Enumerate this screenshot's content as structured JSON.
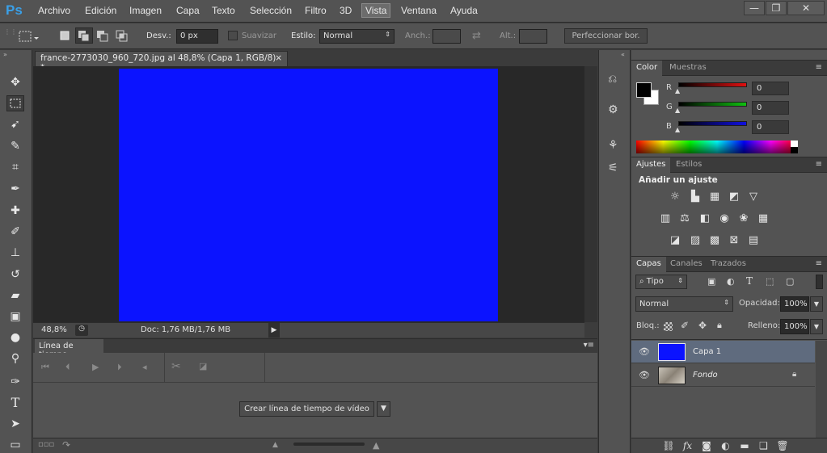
{
  "app": {
    "logo": "Ps",
    "window_buttons": [
      "—",
      "❐",
      "✕"
    ]
  },
  "menu": [
    "Archivo",
    "Edición",
    "Imagen",
    "Capa",
    "Texto",
    "Selección",
    "Filtro",
    "3D",
    "Vista",
    "Ventana",
    "Ayuda"
  ],
  "menu_active": "Vista",
  "options": {
    "desv_label": "Desv.:",
    "desv_value": "0 px",
    "suavizar_label": "Suavizar",
    "estilo_label": "Estilo:",
    "estilo_value": "Normal",
    "anch_label": "Anch.:",
    "alt_label": "Alt.:",
    "refine_button": "Perfeccionar bor."
  },
  "document": {
    "tab_title": "france-2773030_960_720.jpg al 48,8% (Capa 1, RGB/8) *",
    "close": "×",
    "canvas_color": "#0b13ff",
    "zoom": "48,8%",
    "doc_info": "Doc: 1,76 MB/1,76 MB"
  },
  "timeline": {
    "tab": "Línea de tiempo",
    "create_button": "Crear línea de tiempo de vídeo"
  },
  "color_panel": {
    "tabs": [
      "Color",
      "Muestras"
    ],
    "active_tab": "Color",
    "channels": [
      {
        "label": "R",
        "value": "0",
        "color": "#e01010"
      },
      {
        "label": "G",
        "value": "0",
        "color": "#10c010"
      },
      {
        "label": "B",
        "value": "0",
        "color": "#1010e0"
      }
    ],
    "foreground": "#000000",
    "background": "#ffffff"
  },
  "adjust_panel": {
    "tabs": [
      "Ajustes",
      "Estilos"
    ],
    "active_tab": "Ajustes",
    "heading": "Añadir un ajuste"
  },
  "layers_panel": {
    "tabs": [
      "Capas",
      "Canales",
      "Trazados"
    ],
    "active_tab": "Capas",
    "filter_label": "Tipo",
    "blend_mode": "Normal",
    "opacity_label": "Opacidad:",
    "opacity_value": "100%",
    "lock_label": "Bloq.:",
    "fill_label": "Relleno:",
    "fill_value": "100%",
    "layers": [
      {
        "name": "Capa 1",
        "selected": true
      },
      {
        "name": "Fondo",
        "selected": false,
        "locked": true
      }
    ],
    "footer_icons": [
      "link-icon",
      "fx-icon",
      "mask-icon",
      "adjustment-icon",
      "folder-icon",
      "new-layer-icon",
      "trash-icon"
    ]
  }
}
